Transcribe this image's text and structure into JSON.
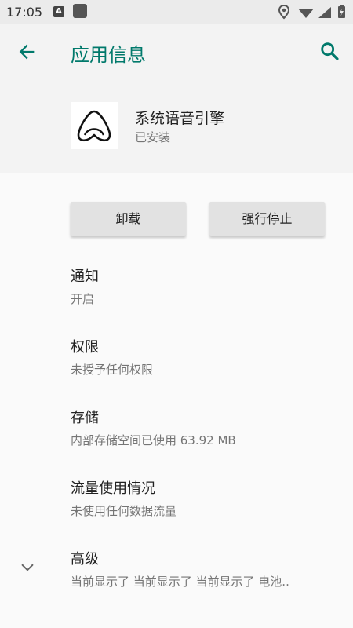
{
  "status_bar": {
    "time": "17:05",
    "a_icon_letter": "A"
  },
  "header": {
    "title": "应用信息"
  },
  "app": {
    "name": "系统语音引擎",
    "status": "已安装"
  },
  "buttons": {
    "uninstall": "卸载",
    "force_stop": "强行停止"
  },
  "items": [
    {
      "title": "通知",
      "subtitle": "开启"
    },
    {
      "title": "权限",
      "subtitle": "未授予任何权限"
    },
    {
      "title": "存储",
      "subtitle": "内部存储空间已使用 63.92 MB"
    },
    {
      "title": "流量使用情况",
      "subtitle": "未使用任何数据流量"
    },
    {
      "title": "高级",
      "subtitle": "当前显示了 当前显示了 当前显示了 电池.."
    }
  ],
  "colors": {
    "accent": "#00796b",
    "status_bar_bg": "#ebebeb",
    "header_bg": "#f3f3f3",
    "button_bg": "#e2e2e2"
  },
  "icons": {
    "back": "arrow-back-icon",
    "search": "search-icon",
    "app": "voice-engine-logo-icon",
    "expand": "chevron-down-icon"
  }
}
